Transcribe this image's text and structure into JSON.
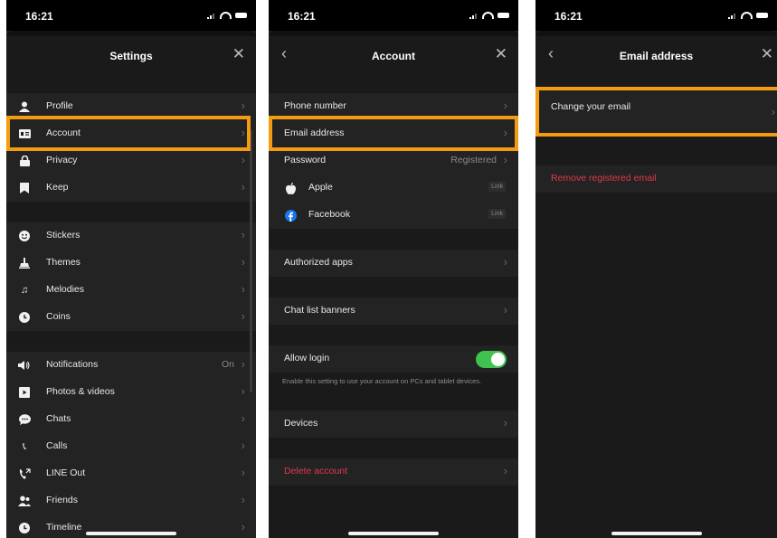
{
  "colors": {
    "highlight": "#f39c12",
    "toggle_on": "#3fc24f",
    "danger": "#e0394b",
    "background": "#1a1a1a"
  },
  "status": {
    "time": "16:21"
  },
  "settings": {
    "title": "Settings",
    "items": [
      {
        "label": "Profile",
        "icon": "person-icon"
      },
      {
        "label": "Account",
        "icon": "id-card-icon"
      },
      {
        "label": "Privacy",
        "icon": "lock-icon"
      },
      {
        "label": "Keep",
        "icon": "bookmark-icon"
      },
      {
        "label": "Stickers",
        "icon": "smiley-icon"
      },
      {
        "label": "Themes",
        "icon": "brush-icon"
      },
      {
        "label": "Melodies",
        "icon": "music-note-icon"
      },
      {
        "label": "Coins",
        "icon": "coin-icon"
      },
      {
        "label": "Notifications",
        "icon": "speaker-icon",
        "value": "On"
      },
      {
        "label": "Photos & videos",
        "icon": "play-icon"
      },
      {
        "label": "Chats",
        "icon": "chat-bubble-icon"
      },
      {
        "label": "Calls",
        "icon": "phone-icon"
      },
      {
        "label": "LINE Out",
        "icon": "phone-out-icon"
      },
      {
        "label": "Friends",
        "icon": "friends-icon"
      },
      {
        "label": "Timeline",
        "icon": "clock-icon"
      }
    ]
  },
  "account": {
    "title": "Account",
    "phone_number": "Phone number",
    "email_address": "Email address",
    "password": "Password",
    "password_value": "Registered",
    "apple": "Apple",
    "apple_badge": "Link",
    "facebook": "Facebook",
    "facebook_badge": "Link",
    "authorized_apps": "Authorized apps",
    "chat_list_banners": "Chat list banners",
    "allow_login": "Allow login",
    "allow_login_on": true,
    "allow_login_note": "Enable this setting to use your account on PCs and tablet devices.",
    "devices": "Devices",
    "delete_account": "Delete account"
  },
  "email": {
    "title": "Email address",
    "change": "Change your email",
    "remove": "Remove registered email"
  }
}
